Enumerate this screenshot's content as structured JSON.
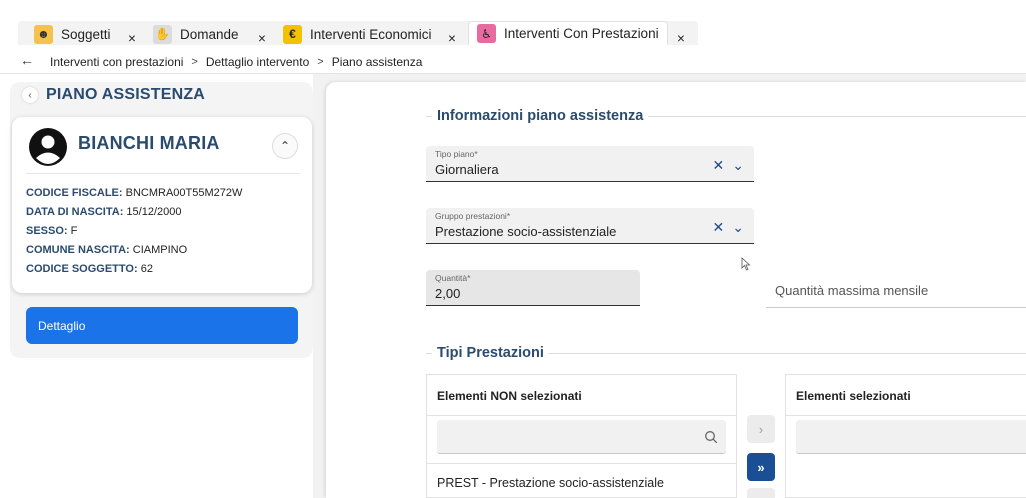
{
  "tabs": [
    {
      "label": "Soggetti",
      "icon": "person-icon"
    },
    {
      "label": "Domande",
      "icon": "hand-icon"
    },
    {
      "label": "Interventi Economici",
      "icon": "euro-icon"
    },
    {
      "label": "Interventi Con Prestazioni",
      "icon": "wheelchair-icon"
    }
  ],
  "breadcrumb": {
    "items": [
      "Interventi con prestazioni",
      "Dettaglio intervento",
      "Piano assistenza"
    ],
    "separator": ">"
  },
  "sidebar": {
    "title": "PIANO ASSISTENZA",
    "person": {
      "name": "BIANCHI MARIA",
      "fields": [
        {
          "label": "CODICE FISCALE:",
          "value": "BNCMRA00T55M272W"
        },
        {
          "label": "DATA DI NASCITA:",
          "value": "15/12/2000"
        },
        {
          "label": "SESSO:",
          "value": "F"
        },
        {
          "label": "COMUNE NASCITA:",
          "value": "CIAMPINO"
        },
        {
          "label": "CODICE SOGGETTO:",
          "value": "62"
        }
      ]
    },
    "detail_button": "Dettaglio"
  },
  "form": {
    "section_title": "Informazioni piano assistenza",
    "tipo_piano": {
      "label": "Tipo piano*",
      "value": "Giornaliera"
    },
    "gruppo_prestazioni": {
      "label": "Gruppo prestazioni*",
      "value": "Prestazione socio-assistenziale"
    },
    "quantita": {
      "label": "Quantità*",
      "value": "2,00"
    },
    "quantita_max": {
      "placeholder": "Quantità massima mensile"
    }
  },
  "tipi_prestazioni": {
    "section_title": "Tipi Prestazioni",
    "left_list": {
      "header": "Elementi NON selezionati",
      "items": [
        "PREST - Prestazione socio-assistenziale"
      ]
    },
    "right_list": {
      "header": "Elementi selezionati",
      "items": []
    },
    "buttons": {
      "move_one": "›",
      "move_all": "»"
    }
  },
  "colors": {
    "accent": "#2a4b6e",
    "primary_button": "#1a73e8",
    "move_all_button": "#1a4f96",
    "close_badge": "#c8102e"
  }
}
